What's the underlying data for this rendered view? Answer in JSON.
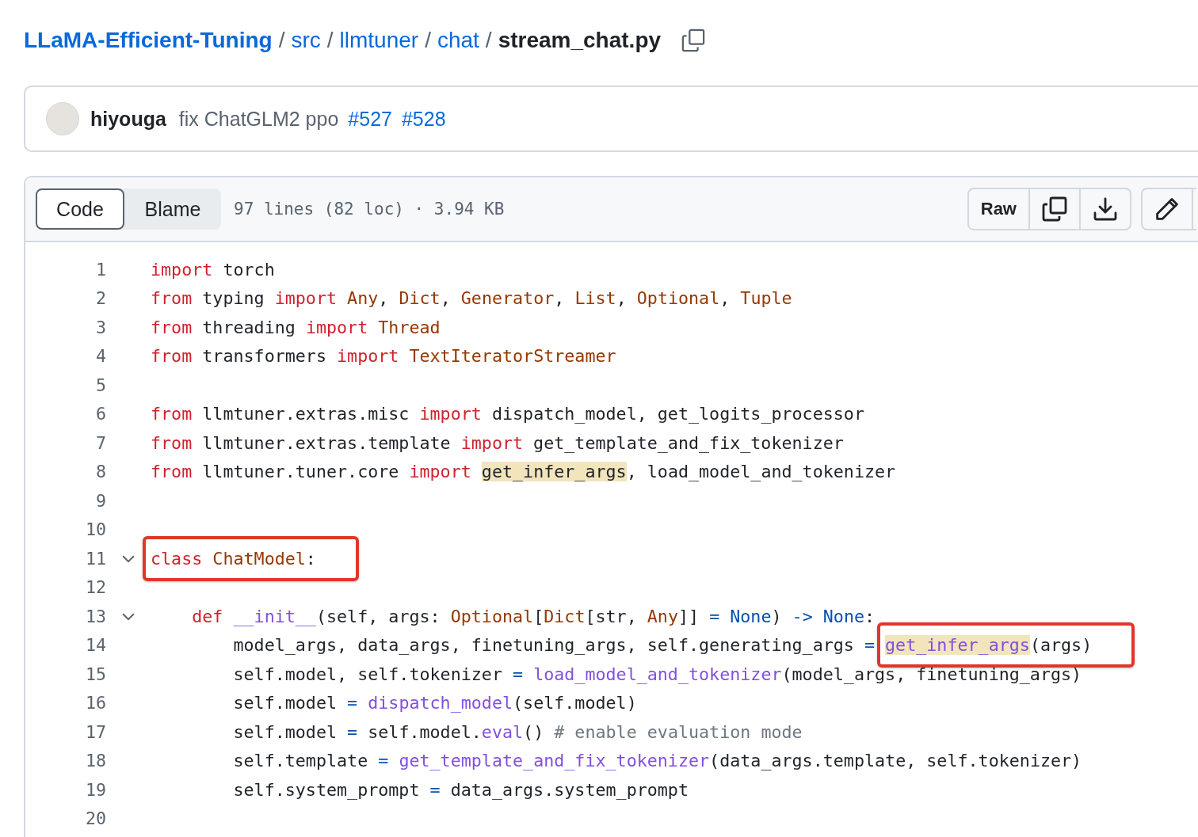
{
  "breadcrumb": {
    "parts": [
      "LLaMA-Efficient-Tuning",
      "src",
      "llmtuner",
      "chat"
    ],
    "separator": "/",
    "file": "stream_chat.py"
  },
  "commit": {
    "author": "hiyouga",
    "message": "fix ChatGLM2 ppo",
    "refs": [
      "#527",
      "#528"
    ]
  },
  "file_header": {
    "tabs": [
      {
        "label": "Code",
        "selected": true
      },
      {
        "label": "Blame",
        "selected": false
      }
    ],
    "info": "97 lines (82 loc) · 3.94 KB",
    "raw": "Raw"
  },
  "code": [
    {
      "number": "1",
      "foldable": false,
      "tokens": [
        {
          "kind": "kw",
          "text": "import"
        },
        {
          "kind": "plain",
          "text": " torch"
        }
      ]
    },
    {
      "number": "2",
      "foldable": false,
      "tokens": [
        {
          "kind": "kw",
          "text": "from"
        },
        {
          "kind": "plain",
          "text": " typing "
        },
        {
          "kind": "kw",
          "text": "import "
        },
        {
          "kind": "cls",
          "text": "Any"
        },
        {
          "kind": "plain",
          "text": ", "
        },
        {
          "kind": "cls",
          "text": "Dict"
        },
        {
          "kind": "plain",
          "text": ", "
        },
        {
          "kind": "cls",
          "text": "Generator"
        },
        {
          "kind": "plain",
          "text": ", "
        },
        {
          "kind": "cls",
          "text": "List"
        },
        {
          "kind": "plain",
          "text": ", "
        },
        {
          "kind": "cls",
          "text": "Optional"
        },
        {
          "kind": "plain",
          "text": ", "
        },
        {
          "kind": "cls",
          "text": "Tuple"
        }
      ]
    },
    {
      "number": "3",
      "foldable": false,
      "tokens": [
        {
          "kind": "kw",
          "text": "from"
        },
        {
          "kind": "plain",
          "text": " threading "
        },
        {
          "kind": "kw",
          "text": "import "
        },
        {
          "kind": "cls",
          "text": "Thread"
        }
      ]
    },
    {
      "number": "4",
      "foldable": false,
      "tokens": [
        {
          "kind": "kw",
          "text": "from"
        },
        {
          "kind": "plain",
          "text": " transformers "
        },
        {
          "kind": "kw",
          "text": "import "
        },
        {
          "kind": "cls",
          "text": "TextIteratorStreamer"
        }
      ]
    },
    {
      "number": "5",
      "foldable": false
    },
    {
      "number": "6",
      "foldable": false,
      "tokens": [
        {
          "kind": "kw",
          "text": "from"
        },
        {
          "kind": "plain",
          "text": " llmtuner.extras.misc "
        },
        {
          "kind": "kw",
          "text": "import"
        },
        {
          "kind": "plain",
          "text": " dispatch_model, get_logits_processor"
        }
      ]
    },
    {
      "number": "7",
      "foldable": false,
      "tokens": [
        {
          "kind": "kw",
          "text": "from"
        },
        {
          "kind": "plain",
          "text": " llmtuner.extras.template "
        },
        {
          "kind": "kw",
          "text": "import"
        },
        {
          "kind": "plain",
          "text": " get_template_and_fix_tokenizer"
        }
      ]
    },
    {
      "number": "8",
      "foldable": false,
      "tokens": [
        {
          "kind": "kw",
          "text": "from"
        },
        {
          "kind": "plain",
          "text": " llmtuner.tuner.core "
        },
        {
          "kind": "kw",
          "text": "import "
        },
        {
          "kind": "plain",
          "text": "get_infer_args",
          "highlight": true
        },
        {
          "kind": "plain",
          "text": ", load_model_and_tokenizer"
        }
      ]
    },
    {
      "number": "9",
      "foldable": false
    },
    {
      "number": "10",
      "foldable": false
    },
    {
      "number": "11",
      "foldable": true,
      "tokens": [
        {
          "kind": "box",
          "tokens": [
            {
              "kind": "kw",
              "text": "class "
            },
            {
              "kind": "cls",
              "text": "ChatModel"
            },
            {
              "kind": "plain",
              "text": ":"
            }
          ]
        }
      ]
    },
    {
      "number": "12",
      "foldable": false
    },
    {
      "number": "13",
      "foldable": true,
      "tokens": [
        {
          "kind": "kw",
          "text": "    def "
        },
        {
          "kind": "fn",
          "text": "__init__"
        },
        {
          "kind": "plain",
          "text": "(self, args: "
        },
        {
          "kind": "cls",
          "text": "Optional"
        },
        {
          "kind": "plain",
          "text": "["
        },
        {
          "kind": "cls",
          "text": "Dict"
        },
        {
          "kind": "plain",
          "text": "[str, "
        },
        {
          "kind": "cls",
          "text": "Any"
        },
        {
          "kind": "plain",
          "text": "]] "
        },
        {
          "kind": "const",
          "text": "= None"
        },
        {
          "kind": "plain",
          "text": ") "
        },
        {
          "kind": "const",
          "text": "-> None"
        },
        {
          "kind": "plain",
          "text": ":"
        }
      ]
    },
    {
      "number": "14",
      "foldable": false,
      "tokens": [
        {
          "kind": "plain",
          "text": "        model_args, data_args, finetuning_args, self.generating_args "
        },
        {
          "kind": "const",
          "text": "= "
        },
        {
          "kind": "box",
          "tokens": [
            {
              "kind": "fn",
              "text": "get_infer_args",
              "highlight": true
            },
            {
              "kind": "plain",
              "text": "(args)"
            }
          ]
        }
      ]
    },
    {
      "number": "15",
      "foldable": false,
      "tokens": [
        {
          "kind": "plain",
          "text": "        self.model, self.tokenizer "
        },
        {
          "kind": "const",
          "text": "= "
        },
        {
          "kind": "fn",
          "text": "load_model_and_tokenizer"
        },
        {
          "kind": "plain",
          "text": "(model_args, finetuning_args)"
        }
      ]
    },
    {
      "number": "16",
      "foldable": false,
      "tokens": [
        {
          "kind": "plain",
          "text": "        self.model "
        },
        {
          "kind": "const",
          "text": "= "
        },
        {
          "kind": "fn",
          "text": "dispatch_model"
        },
        {
          "kind": "plain",
          "text": "(self.model)"
        }
      ]
    },
    {
      "number": "17",
      "foldable": false,
      "tokens": [
        {
          "kind": "plain",
          "text": "        self.model "
        },
        {
          "kind": "const",
          "text": "="
        },
        {
          "kind": "plain",
          "text": " self.model."
        },
        {
          "kind": "fn",
          "text": "eval"
        },
        {
          "kind": "plain",
          "text": "() "
        },
        {
          "kind": "comment",
          "text": "# enable evaluation mode"
        }
      ]
    },
    {
      "number": "18",
      "foldable": false,
      "tokens": [
        {
          "kind": "plain",
          "text": "        self.template "
        },
        {
          "kind": "const",
          "text": "= "
        },
        {
          "kind": "fn",
          "text": "get_template_and_fix_tokenizer"
        },
        {
          "kind": "plain",
          "text": "(data_args.template, self.tokenizer)"
        }
      ]
    },
    {
      "number": "19",
      "foldable": false,
      "tokens": [
        {
          "kind": "plain",
          "text": "        self.system_prompt "
        },
        {
          "kind": "const",
          "text": "="
        },
        {
          "kind": "plain",
          "text": " data_args.system_prompt"
        }
      ]
    },
    {
      "number": "20",
      "foldable": false
    }
  ]
}
